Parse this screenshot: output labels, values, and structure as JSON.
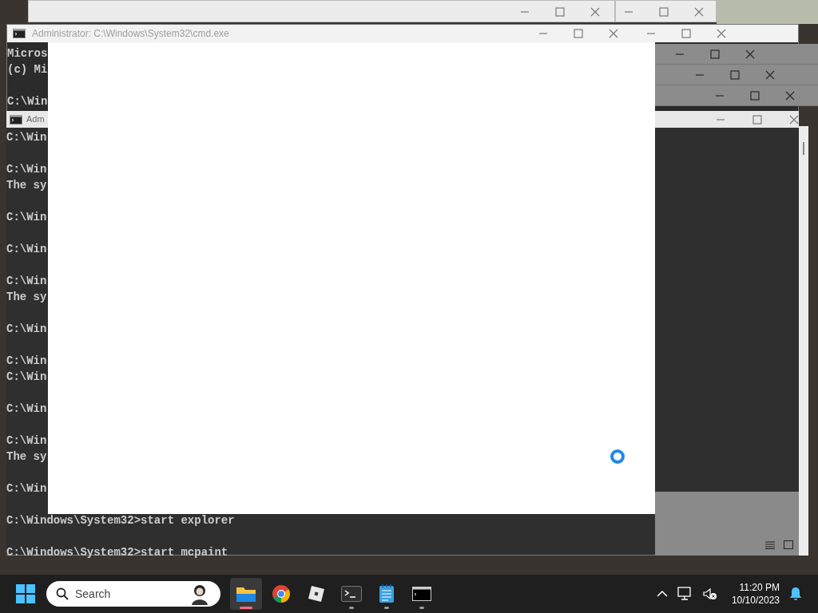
{
  "cmd_window": {
    "title": "Administrator: C:\\Windows\\System32\\cmd.exe",
    "blocks": [
      [
        "Micros",
        "(c) Mi"
      ],
      [
        "C:\\Win"
      ]
    ]
  },
  "cmd_window_2": {
    "title": "Adm",
    "blocks": [
      [
        "C:\\Win"
      ],
      [
        "C:\\Win",
        "The sy"
      ],
      [
        "C:\\Win"
      ],
      [
        "C:\\Win"
      ],
      [
        "C:\\Win",
        "The sy"
      ],
      [
        "C:\\Win"
      ],
      [
        "C:\\Win",
        "C:\\Win"
      ],
      [
        "C:\\Win"
      ],
      [
        "C:\\Win",
        "The sy"
      ],
      [
        "C:\\Win"
      ],
      [
        "C:\\Windows\\System32>start explorer"
      ],
      [
        "C:\\Windows\\System32>start mcpaint"
      ]
    ]
  },
  "loading_window": {
    "busy": true
  },
  "taskbar": {
    "search": {
      "placeholder": "Search"
    },
    "apps": [
      {
        "kind": "explorer",
        "selected": true,
        "running": true
      },
      {
        "kind": "chrome",
        "selected": false,
        "running": false
      },
      {
        "kind": "roblox",
        "selected": false,
        "running": false
      },
      {
        "kind": "terminal",
        "selected": false,
        "running": true
      },
      {
        "kind": "notepad",
        "selected": false,
        "running": true
      },
      {
        "kind": "cmd",
        "selected": false,
        "running": true
      }
    ],
    "time": "11:20 PM",
    "date": "10/10/2023"
  }
}
